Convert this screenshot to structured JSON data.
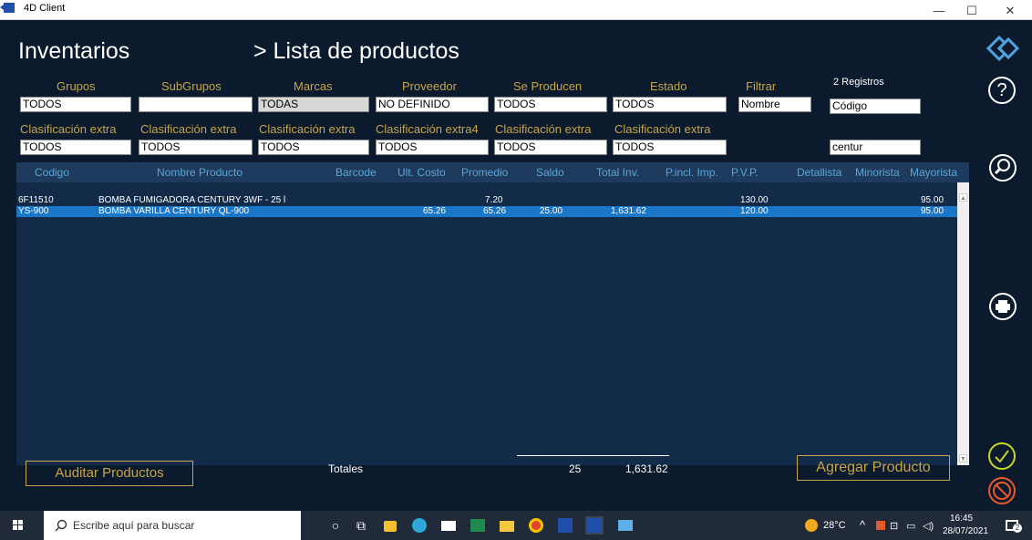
{
  "window": {
    "title": "4D Client",
    "minimize": "—",
    "maximize": "☐",
    "close": "✕"
  },
  "header": {
    "title": "Inventarios",
    "subtitle": "> Lista de productos"
  },
  "filters": {
    "labels": [
      "Grupos",
      "SubGrupos",
      "Marcas",
      "Proveedor",
      "Se Producen",
      "Estado",
      "Filtrar"
    ],
    "values": [
      "TODOS",
      "",
      "TODAS",
      "NO DEFINIDO",
      "TODOS",
      "TODOS",
      "Nombre"
    ],
    "records_label": "2 Registros",
    "codigo_value": "Código",
    "extra_labels": [
      "Clasificación extra",
      "Clasificación extra",
      "Clasificación extra",
      "Clasificación extra4",
      "Clasificación extra",
      "Clasificación extra"
    ],
    "extra_values": [
      "TODOS",
      "TODOS",
      "TODOS",
      "TODOS",
      "TODOS",
      "TODOS"
    ],
    "search_value": "centur"
  },
  "grid": {
    "columns": [
      "Codigo",
      "Nombre Producto",
      "Barcode",
      "Ult. Costo",
      "Promedio",
      "Saldo",
      "Total Inv.",
      "P.incl. Imp.",
      "P.V.P.",
      "Detallista",
      "Minorista",
      "Mayorista"
    ],
    "rows": [
      {
        "codigo": "6F11510",
        "nombre": "BOMBA FUMIGADORA CENTURY 3WF - 25 l",
        "barcode": "",
        "ult_costo": "",
        "promedio": "7.20",
        "saldo": "",
        "total_inv": "",
        "p_incl": "",
        "pvp": "130.00",
        "detallista": "",
        "minorista": "",
        "mayorista": "95.00",
        "selected": false
      },
      {
        "codigo": "YS-900",
        "nombre": "BOMBA VARILLA CENTURY QL-900",
        "barcode": "",
        "ult_costo": "65.26",
        "promedio": "65.26",
        "saldo": "25.00",
        "total_inv": "1,631.62",
        "p_incl": "",
        "pvp": "120.00",
        "detallista": "",
        "minorista": "",
        "mayorista": "95.00",
        "selected": true
      }
    ]
  },
  "footer": {
    "audit_button": "Auditar Productos",
    "totals_label": "Totales",
    "total_saldo": "25",
    "total_inv": "1,631.62",
    "add_button": "Agregar Producto"
  },
  "taskbar": {
    "search_placeholder": "Escribe aquí para buscar",
    "weather": "28°C",
    "time": "16:45",
    "date": "28/07/2021",
    "notifications": "2"
  },
  "colors": {
    "background": "#0b1a2c",
    "accent_gold": "#c8a548",
    "header_text": "#5aa7d8",
    "selected_row": "#1a76c7"
  }
}
